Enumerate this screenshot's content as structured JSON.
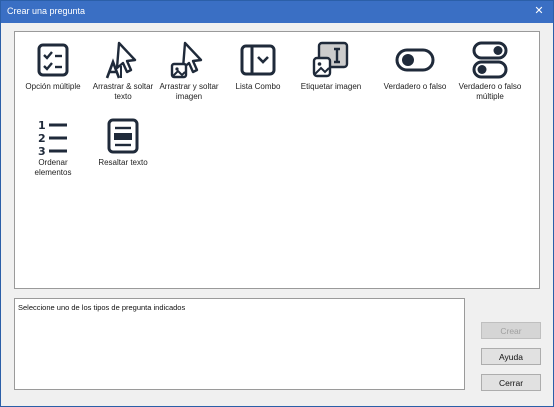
{
  "window": {
    "title": "Crear una pregunta",
    "close_glyph": "✕"
  },
  "question_types": [
    {
      "label": "Opción múltiple",
      "icon": "multiple-choice-icon"
    },
    {
      "label": "Arrastrar & soltar texto",
      "icon": "drag-drop-text-icon"
    },
    {
      "label": "Arrastrar y soltar imagen",
      "icon": "drag-drop-image-icon"
    },
    {
      "label": "Lista Combo",
      "icon": "combo-list-icon"
    },
    {
      "label": "Etiquetar imagen",
      "icon": "label-image-icon"
    },
    {
      "label": "Verdadero o falso",
      "icon": "toggle-icon"
    },
    {
      "label": "Verdadero o falso múltiple",
      "icon": "multiple-toggle-icon"
    },
    {
      "label": "Ordenar elementos",
      "icon": "numbered-list-icon"
    },
    {
      "label": "Resaltar texto",
      "icon": "highlight-text-icon"
    }
  ],
  "description": "Seleccione uno de los tipos de pregunta indicados",
  "buttons": {
    "create": "Crear",
    "help": "Ayuda",
    "close": "Cerrar"
  },
  "colors": {
    "titlebar": "#3a6fc4",
    "icon": "#1f2a3a"
  }
}
